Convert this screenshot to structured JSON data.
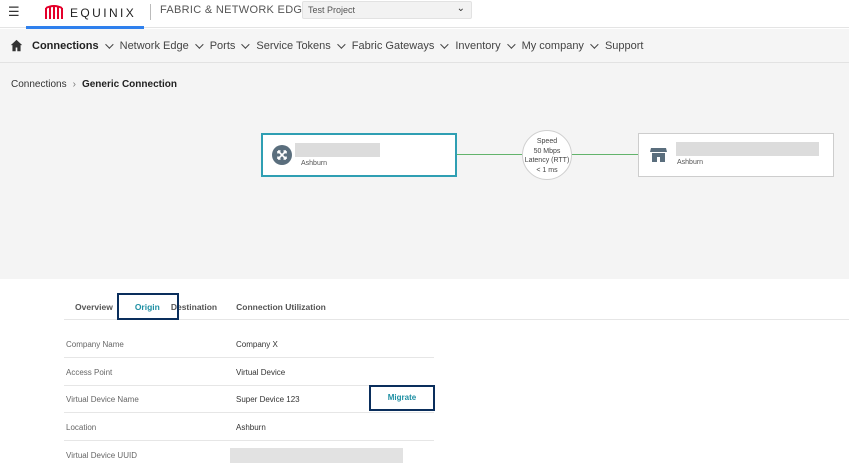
{
  "header": {
    "menu_icon": "hamburger-icon",
    "logo_text": "EQUINIX",
    "product_name": "FABRIC & NETWORK EDGE",
    "project_selector": {
      "value": "Test Project",
      "icon": "chevron-down-icon"
    },
    "accent_color": "#2f80ed",
    "brand_color": "#e4002b"
  },
  "nav": {
    "home_icon": "home-icon",
    "items": [
      {
        "label": "Connections",
        "active": true
      },
      {
        "label": "Network Edge"
      },
      {
        "label": "Ports"
      },
      {
        "label": "Service Tokens"
      },
      {
        "label": "Fabric Gateways"
      },
      {
        "label": "Inventory"
      },
      {
        "label": "My company"
      },
      {
        "label": "Support",
        "no_dropdown": true
      }
    ]
  },
  "breadcrumb": {
    "parent": "Connections",
    "current": "Generic Connection"
  },
  "diagram": {
    "a_side": {
      "location": "Ashburn",
      "icon": "virtual-device-icon"
    },
    "z_side": {
      "location": "Ashburn",
      "icon": "storefront-icon"
    },
    "metric": {
      "speed_label": "Speed",
      "speed_value": "50 Mbps",
      "latency_label": "Latency (RTT)",
      "latency_value": "< 1 ms"
    },
    "link_color": "#62b36b"
  },
  "tabs": [
    {
      "label": "Overview"
    },
    {
      "label": "Origin",
      "active": true
    },
    {
      "label": "Destination"
    },
    {
      "label": "Connection Utilization"
    }
  ],
  "details": [
    {
      "key": "Company Name",
      "value": "Company X"
    },
    {
      "key": "Access Point",
      "value": "Virtual Device"
    },
    {
      "key": "Virtual Device Name",
      "value": "Super Device 123"
    },
    {
      "key": "Location",
      "value": "Ashburn"
    },
    {
      "key": "Virtual Device UUID",
      "value": ""
    }
  ],
  "migrate_button": "Migrate"
}
